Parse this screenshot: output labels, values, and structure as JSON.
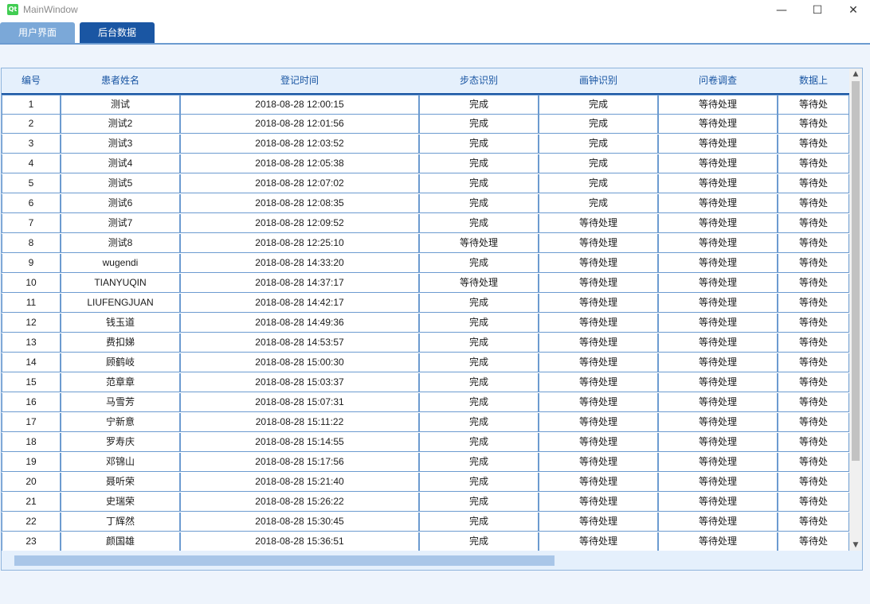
{
  "window": {
    "app_icon_text": "Qt",
    "title": "MainWindow",
    "minimize": "—",
    "maximize": "☐",
    "close": "✕"
  },
  "tabs": [
    {
      "label": "用户界面"
    },
    {
      "label": "后台数据"
    }
  ],
  "table": {
    "headers": [
      "编号",
      "患者姓名",
      "登记时间",
      "步态识别",
      "画钟识别",
      "问卷调查",
      "数据上"
    ],
    "rows": [
      [
        "1",
        "测试",
        "2018-08-28 12:00:15",
        "完成",
        "完成",
        "等待处理",
        "等待处"
      ],
      [
        "2",
        "测试2",
        "2018-08-28 12:01:56",
        "完成",
        "完成",
        "等待处理",
        "等待处"
      ],
      [
        "3",
        "测试3",
        "2018-08-28 12:03:52",
        "完成",
        "完成",
        "等待处理",
        "等待处"
      ],
      [
        "4",
        "测试4",
        "2018-08-28 12:05:38",
        "完成",
        "完成",
        "等待处理",
        "等待处"
      ],
      [
        "5",
        "测试5",
        "2018-08-28 12:07:02",
        "完成",
        "完成",
        "等待处理",
        "等待处"
      ],
      [
        "6",
        "测试6",
        "2018-08-28 12:08:35",
        "完成",
        "完成",
        "等待处理",
        "等待处"
      ],
      [
        "7",
        "测试7",
        "2018-08-28 12:09:52",
        "完成",
        "等待处理",
        "等待处理",
        "等待处"
      ],
      [
        "8",
        "测试8",
        "2018-08-28 12:25:10",
        "等待处理",
        "等待处理",
        "等待处理",
        "等待处"
      ],
      [
        "9",
        "wugendi",
        "2018-08-28 14:33:20",
        "完成",
        "等待处理",
        "等待处理",
        "等待处"
      ],
      [
        "10",
        "TIANYUQIN",
        "2018-08-28 14:37:17",
        "等待处理",
        "等待处理",
        "等待处理",
        "等待处"
      ],
      [
        "11",
        "LIUFENGJUAN",
        "2018-08-28 14:42:17",
        "完成",
        "等待处理",
        "等待处理",
        "等待处"
      ],
      [
        "12",
        "钱玉道",
        "2018-08-28 14:49:36",
        "完成",
        "等待处理",
        "等待处理",
        "等待处"
      ],
      [
        "13",
        "费扣娣",
        "2018-08-28 14:53:57",
        "完成",
        "等待处理",
        "等待处理",
        "等待处"
      ],
      [
        "14",
        "顾鹤岐",
        "2018-08-28 15:00:30",
        "完成",
        "等待处理",
        "等待处理",
        "等待处"
      ],
      [
        "15",
        "范章章",
        "2018-08-28 15:03:37",
        "完成",
        "等待处理",
        "等待处理",
        "等待处"
      ],
      [
        "16",
        "马雪芳",
        "2018-08-28 15:07:31",
        "完成",
        "等待处理",
        "等待处理",
        "等待处"
      ],
      [
        "17",
        "宁新意",
        "2018-08-28 15:11:22",
        "完成",
        "等待处理",
        "等待处理",
        "等待处"
      ],
      [
        "18",
        "罗寿庆",
        "2018-08-28 15:14:55",
        "完成",
        "等待处理",
        "等待处理",
        "等待处"
      ],
      [
        "19",
        "邓锦山",
        "2018-08-28 15:17:56",
        "完成",
        "等待处理",
        "等待处理",
        "等待处"
      ],
      [
        "20",
        "聂听荣",
        "2018-08-28 15:21:40",
        "完成",
        "等待处理",
        "等待处理",
        "等待处"
      ],
      [
        "21",
        "史瑞荣",
        "2018-08-28 15:26:22",
        "完成",
        "等待处理",
        "等待处理",
        "等待处"
      ],
      [
        "22",
        "丁辉然",
        "2018-08-28 15:30:45",
        "完成",
        "等待处理",
        "等待处理",
        "等待处"
      ],
      [
        "23",
        "颜国雄",
        "2018-08-28 15:36:51",
        "完成",
        "等待处理",
        "等待处理",
        "等待处"
      ]
    ]
  },
  "scrollbar": {
    "up_arrow": "▲",
    "down_arrow": "▼"
  },
  "colors": {
    "accent": "#1a56a3",
    "tab_inactive": "#7ba8d8",
    "grid": "#6c9bd0",
    "header_bg": "#e5f0fc"
  }
}
